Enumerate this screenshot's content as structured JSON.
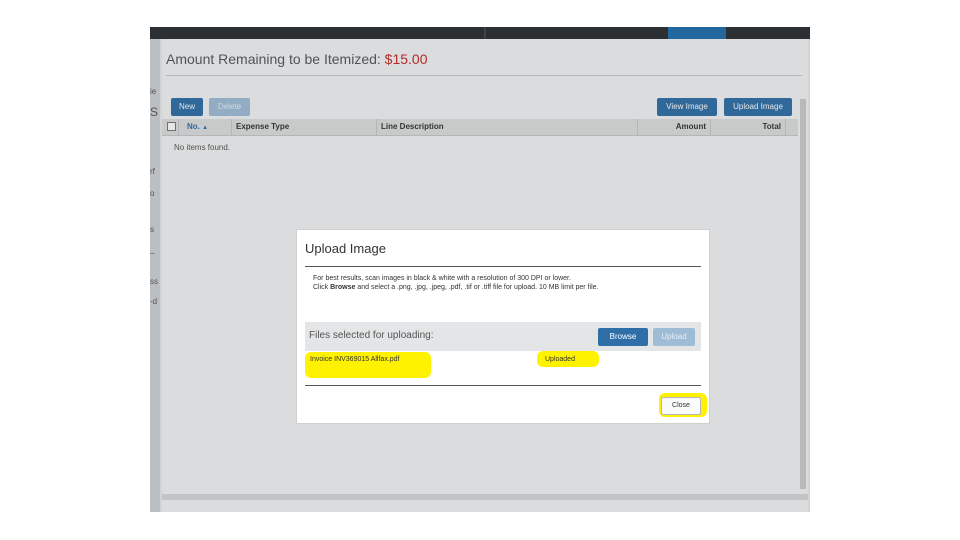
{
  "page": {
    "heading_label": "Amount Remaining to be Itemized:",
    "heading_amount": "$15.00",
    "colors": {
      "accent": "#2f6fa8",
      "amount": "#c62828",
      "highlight": "#fff200"
    }
  },
  "toolbar": {
    "new_label": "New",
    "delete_label": "Delete",
    "view_image_label": "View Image",
    "upload_image_label": "Upload Image"
  },
  "grid": {
    "columns": [
      "No.",
      "Expense Type",
      "Line Description",
      "Amount",
      "Total"
    ],
    "empty_text": "No items found."
  },
  "modal": {
    "title": "Upload Image",
    "info_line1": "For best results, scan images in black & white with a resolution of 300 DPI or lower.",
    "info_line2_pre": "Click ",
    "info_line2_bold1": "Browse",
    "info_line2_mid": " and select a .png, .jpg, .jpeg, .pdf, .tif or .tiff file for upload. 10 MB limit per file.",
    "files_header": "Files selected for uploading:",
    "browse_label": "Browse",
    "upload_label": "Upload",
    "file": {
      "name": "Invoice INV369015 Allfax.pdf",
      "status": "Uploaded"
    },
    "close_label": "Close"
  }
}
